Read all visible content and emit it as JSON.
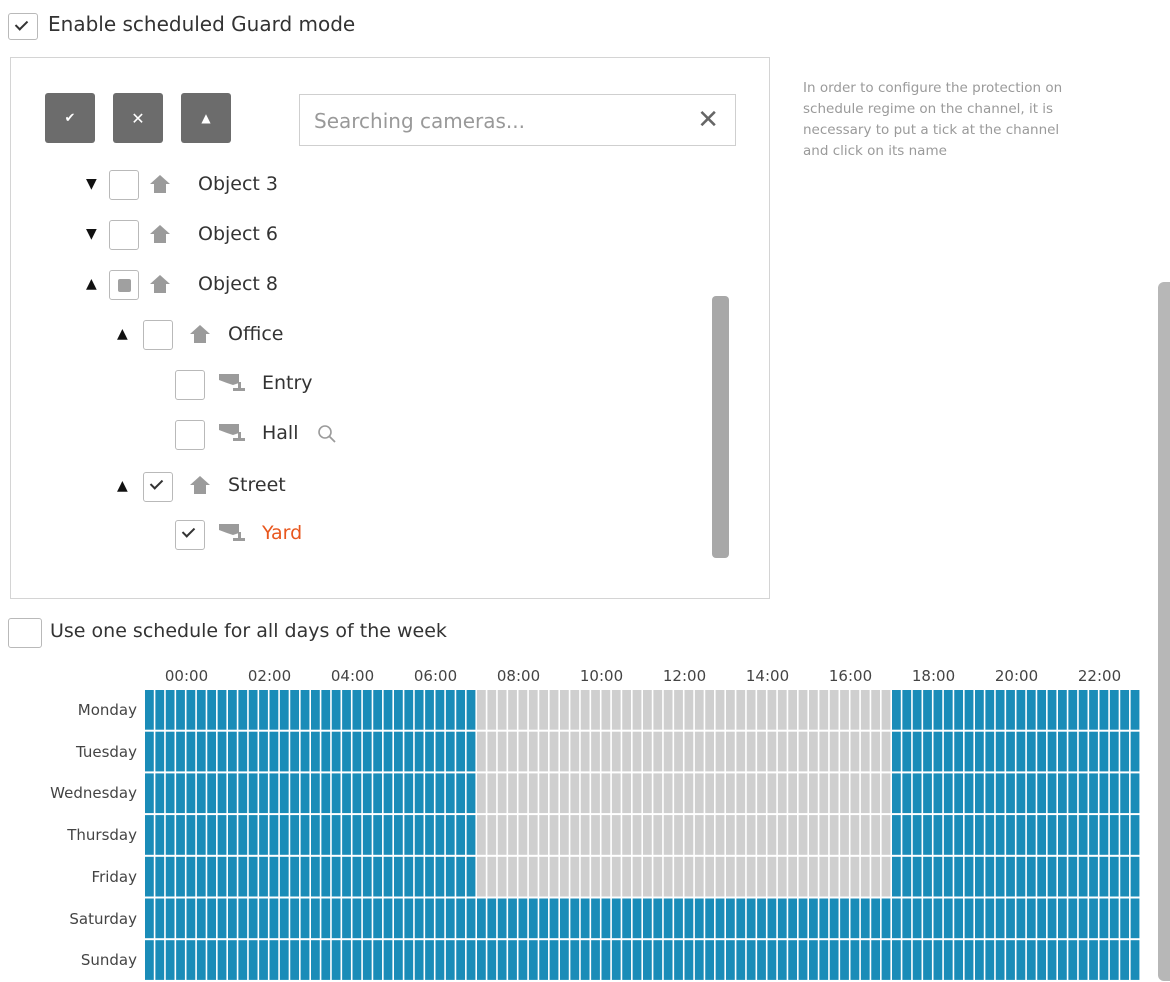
{
  "guard_mode": {
    "label": "Enable scheduled Guard mode",
    "checked": true
  },
  "toolbar": {
    "check_icon": "check-icon",
    "clear_icon": "close-icon",
    "collapse_icon": "collapse-up-icon"
  },
  "search": {
    "placeholder": "Searching cameras...",
    "value": "",
    "clear_icon": "close-icon"
  },
  "tree": [
    {
      "label": "Object 3",
      "type": "object",
      "expander": "collapsed",
      "state": "unchecked"
    },
    {
      "label": "Object 6",
      "type": "object",
      "expander": "collapsed",
      "state": "unchecked"
    },
    {
      "label": "Object 8",
      "type": "object",
      "expander": "expanded",
      "state": "partial"
    },
    {
      "label": "Office",
      "type": "object",
      "expander": "expanded",
      "state": "unchecked"
    },
    {
      "label": "Entry",
      "type": "camera",
      "state": "unchecked"
    },
    {
      "label": "Hall",
      "type": "camera",
      "state": "unchecked",
      "extra_icon": "search-icon"
    },
    {
      "label": "Street",
      "type": "object",
      "expander": "expanded",
      "state": "checked"
    },
    {
      "label": "Yard",
      "type": "camera",
      "state": "checked",
      "selected": true
    }
  ],
  "help_text": "In order to configure the protection on schedule regime on the channel, it is necessary to put a tick at the channel and click on its name",
  "one_schedule": {
    "label": "Use one schedule for all days of the week",
    "checked": false
  },
  "schedule": {
    "hour_labels": [
      "00:00",
      "02:00",
      "04:00",
      "06:00",
      "08:00",
      "10:00",
      "12:00",
      "14:00",
      "16:00",
      "18:00",
      "20:00",
      "22:00"
    ],
    "days": [
      "Monday",
      "Tuesday",
      "Wednesday",
      "Thursday",
      "Friday",
      "Saturday",
      "Sunday"
    ],
    "slots_per_hour": 4,
    "active_color": "#1a8cb8",
    "inactive_color": "#cfcfcf",
    "active_ranges": [
      [
        [
          0,
          8
        ],
        [
          18,
          24
        ]
      ],
      [
        [
          0,
          8
        ],
        [
          18,
          24
        ]
      ],
      [
        [
          0,
          8
        ],
        [
          18,
          24
        ]
      ],
      [
        [
          0,
          8
        ],
        [
          18,
          24
        ]
      ],
      [
        [
          0,
          8
        ],
        [
          18,
          24
        ]
      ],
      [
        [
          0,
          24
        ]
      ],
      [
        [
          0,
          24
        ]
      ]
    ]
  }
}
